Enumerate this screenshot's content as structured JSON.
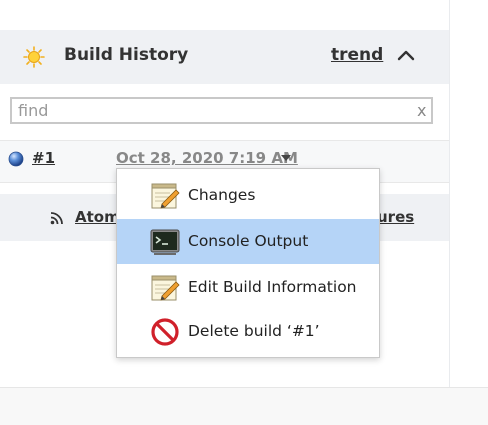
{
  "build_history": {
    "title": "Build History",
    "trend_label": "trend",
    "sun_icon": "sun-icon",
    "collapse_icon": "chevron-up-icon"
  },
  "search": {
    "placeholder": "find",
    "value": "",
    "clear_label": "x"
  },
  "builds": [
    {
      "number": "#1",
      "date": "Oct 28, 2020 7:19 AM",
      "status_icon": "blue-ball-icon"
    }
  ],
  "feeds": {
    "atom_label": "Atom",
    "failures_label": "ures"
  },
  "context_menu": {
    "items": [
      {
        "label": "Changes",
        "icon": "notepad-icon",
        "selected": false
      },
      {
        "label": "Console Output",
        "icon": "terminal-icon",
        "selected": true
      },
      {
        "label": "Edit Build Information",
        "icon": "notepad-icon",
        "selected": false
      },
      {
        "label": "Delete build ‘#1’",
        "icon": "no-entry-icon",
        "selected": false
      }
    ]
  },
  "colors": {
    "header_bg": "#eff1f4",
    "selected_bg": "#b5d4f7",
    "link_text": "#333333",
    "muted_text": "#888888"
  }
}
